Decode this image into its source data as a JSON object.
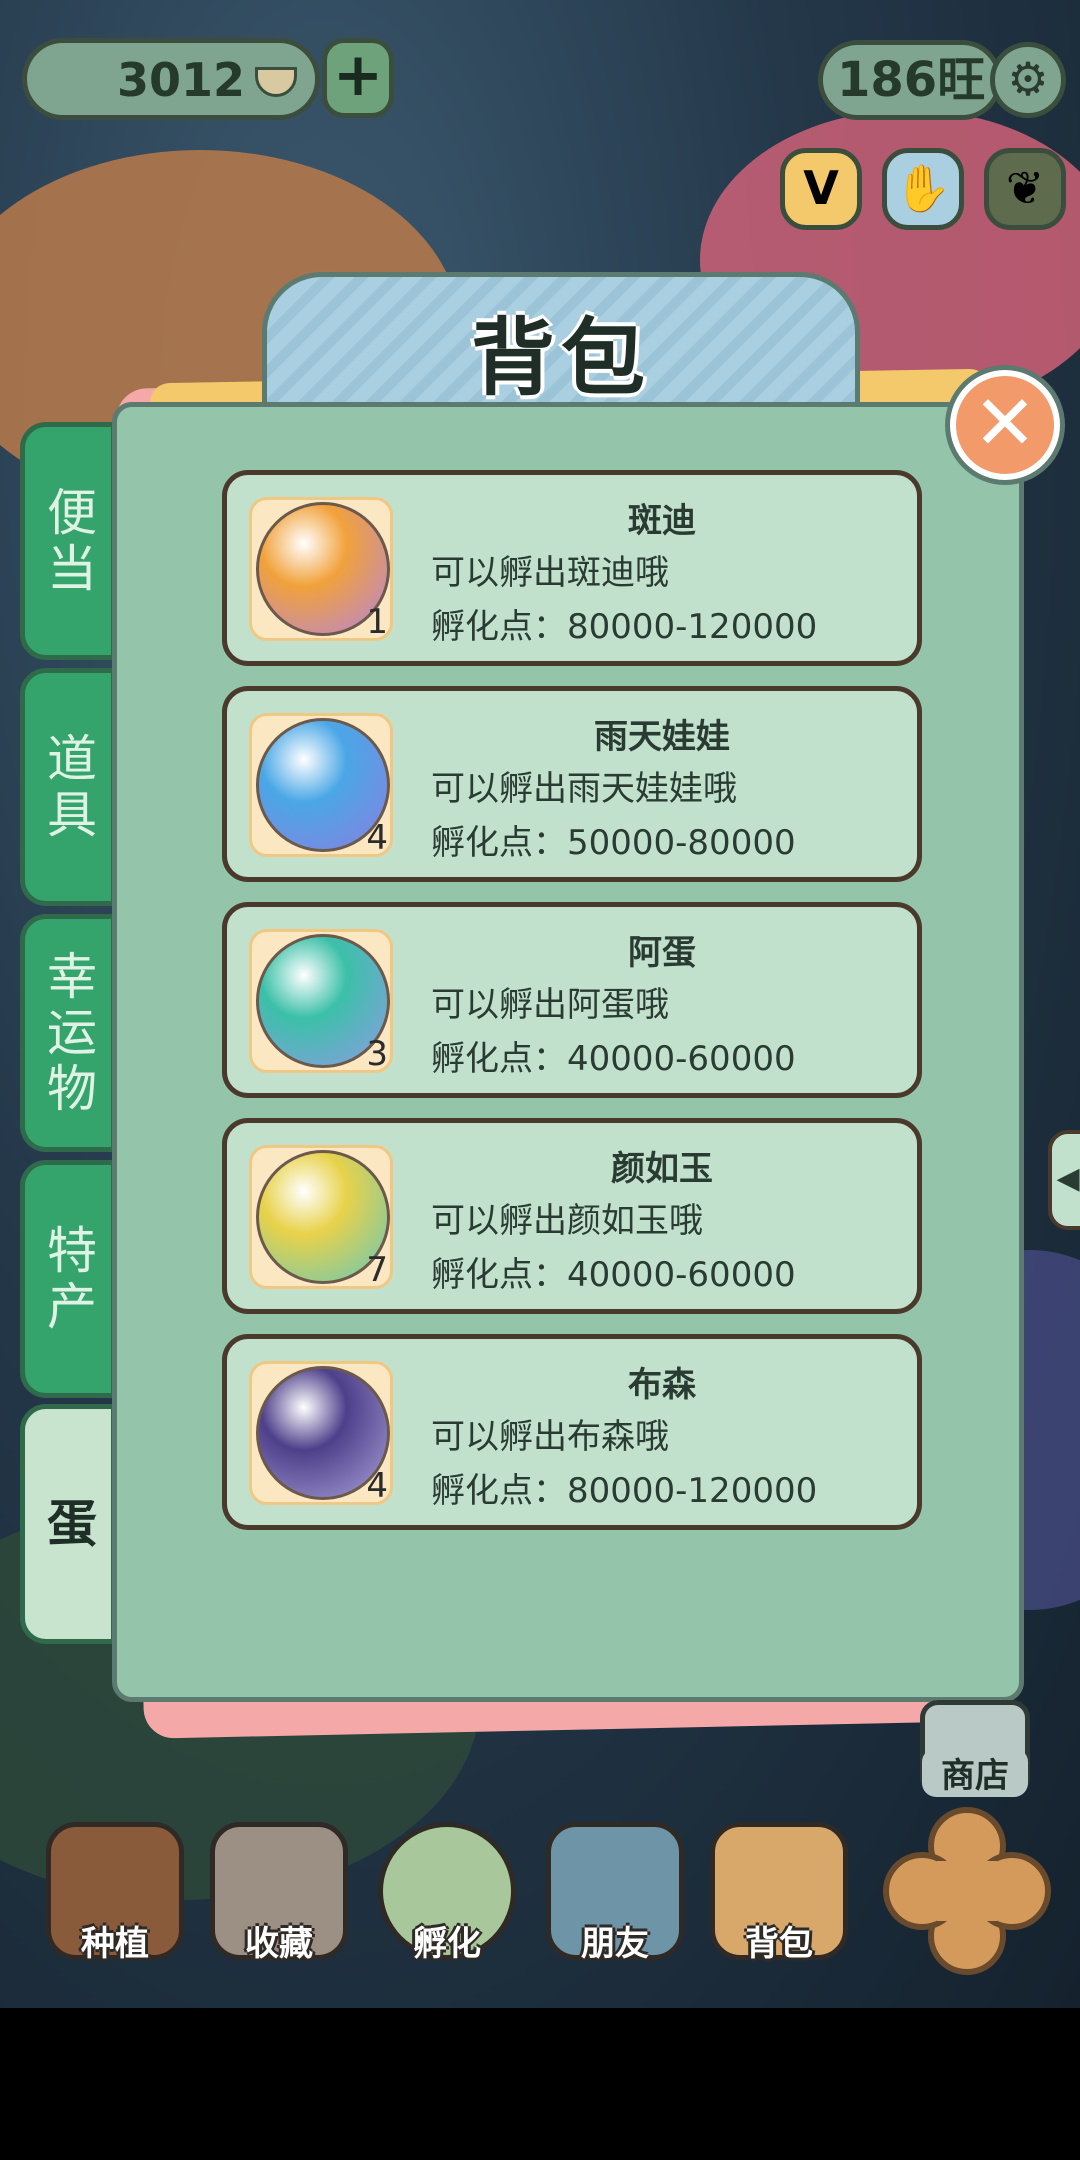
{
  "topbar": {
    "currency_value": "3012",
    "plus_label": "+",
    "wang_value": "186旺",
    "settings_icon": "⚙",
    "round_icons": [
      {
        "name": "v-icon",
        "glyph": "V",
        "color": "#f3c96b"
      },
      {
        "name": "hand-icon",
        "glyph": "✋",
        "color": "#a9cfe0"
      },
      {
        "name": "ginkgo-icon",
        "glyph": "❦",
        "color": "#5e6b4c"
      }
    ]
  },
  "panel": {
    "title": "背包",
    "close_label": "✕",
    "tabs": [
      {
        "label": "便当",
        "active": false
      },
      {
        "label": "道具",
        "active": false
      },
      {
        "label": "幸运物",
        "active": false
      },
      {
        "label": "特产",
        "active": false
      },
      {
        "label": "蛋",
        "active": true
      }
    ],
    "items": [
      {
        "name": "斑迪",
        "desc": "可以孵出斑迪哦",
        "hatch": "孵化点：80000-120000",
        "qty": "1",
        "egg_color": "#f1a23b",
        "egg_color2": "#b683d8"
      },
      {
        "name": "雨天娃娃",
        "desc": "可以孵出雨天娃娃哦",
        "hatch": "孵化点：50000-80000",
        "qty": "4",
        "egg_color": "#4aa7e6",
        "egg_color2": "#8a7fe0"
      },
      {
        "name": "阿蛋",
        "desc": "可以孵出阿蛋哦",
        "hatch": "孵化点：40000-60000",
        "qty": "3",
        "egg_color": "#3bc0a8",
        "egg_color2": "#8f9be6"
      },
      {
        "name": "颜如玉",
        "desc": "可以孵出颜如玉哦",
        "hatch": "孵化点：40000-60000",
        "qty": "7",
        "egg_color": "#e8d24a",
        "egg_color2": "#66c7b7"
      },
      {
        "name": "布森",
        "desc": "可以孵出布森哦",
        "hatch": "孵化点：80000-120000",
        "qty": "4",
        "egg_color": "#4e3f8a",
        "egg_color2": "#a9a1d8"
      }
    ]
  },
  "right_side": {
    "shop_label": "商店",
    "collapse_arrow": "◀"
  },
  "bottom_nav": [
    {
      "label": "种植",
      "name": "nav-plant",
      "color": "#8a5b3b"
    },
    {
      "label": "收藏",
      "name": "nav-collection",
      "color": "#9c8f84"
    },
    {
      "label": "孵化",
      "name": "nav-hatch",
      "color": "#a8c79a"
    },
    {
      "label": "朋友",
      "name": "nav-friends",
      "color": "#6e94a8"
    },
    {
      "label": "背包",
      "name": "nav-bag",
      "color": "#d7a86a"
    }
  ]
}
